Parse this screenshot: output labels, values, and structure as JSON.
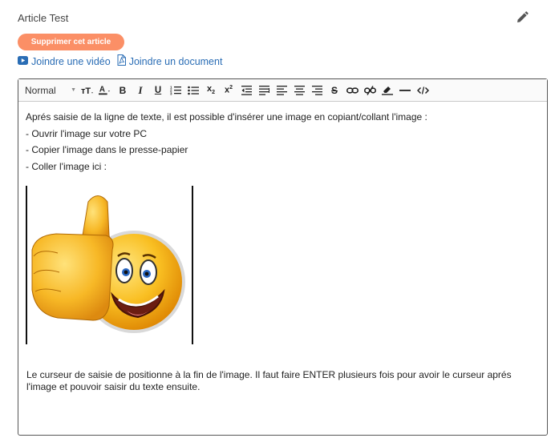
{
  "article": {
    "title": "Article Test"
  },
  "actions": {
    "delete_label": "Supprimer cet article",
    "video_link": "Joindre une vidéo",
    "document_link": "Joindre un document"
  },
  "toolbar": {
    "format_select": "Normal",
    "buttons": [
      {
        "name": "font-size-icon"
      },
      {
        "name": "text-color-icon"
      },
      {
        "name": "bold-icon"
      },
      {
        "name": "italic-icon"
      },
      {
        "name": "underline-icon"
      },
      {
        "name": "ordered-list-icon"
      },
      {
        "name": "bullet-list-icon"
      },
      {
        "name": "subscript-icon"
      },
      {
        "name": "superscript-icon"
      },
      {
        "name": "outdent-icon"
      },
      {
        "name": "justify-icon"
      },
      {
        "name": "align-left-icon"
      },
      {
        "name": "align-center-icon"
      },
      {
        "name": "align-right-icon"
      },
      {
        "name": "strikethrough-icon"
      },
      {
        "name": "link-icon"
      },
      {
        "name": "unlink-icon"
      },
      {
        "name": "clear-format-icon"
      },
      {
        "name": "horizontal-rule-icon"
      },
      {
        "name": "code-view-icon"
      }
    ]
  },
  "content": {
    "lines": [
      "Aprés saisie de la ligne de texte, il est possible d'insérer une image en copiant/collant l'image :",
      "- Ouvrir l'image sur votre PC",
      "- Copier l'image dans le presse-papier",
      "- Coller l'image ici :"
    ],
    "image": "thumbs-up-smiley",
    "footer_text": "Le curseur de saisie de positionne à la fin de l'image. Il faut faire ENTER plusieurs fois pour avoir le curseur aprés l'image et pouvoir saisir du texte ensuite."
  },
  "colors": {
    "accent": "#fb8f66",
    "link": "#2a6db5"
  }
}
